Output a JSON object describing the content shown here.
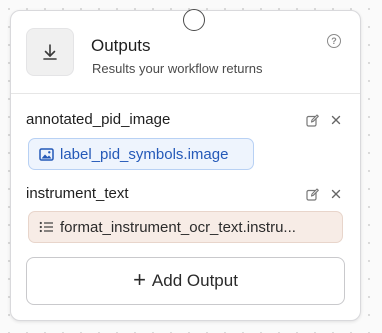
{
  "node": {
    "title": "Outputs",
    "subtitle": "Results your workflow returns",
    "header_icon": "download-arrow-icon",
    "help_icon": "question-circle-icon"
  },
  "outputs": [
    {
      "name": "annotated_pid_image",
      "value": "label_pid_symbols.image",
      "value_icon": "image-icon",
      "chip_color": "#eef4fd",
      "text_color": "#2459b8"
    },
    {
      "name": "instrument_text",
      "value": "format_instrument_ocr_text.instru...",
      "value_icon": "list-icon",
      "chip_color": "#f7ece6",
      "text_color": "#2b2b2b"
    }
  ],
  "add_button": {
    "label": "Add Output",
    "icon": "plus-icon"
  },
  "colors": {
    "border": "#d9d9dc",
    "blue_accent": "#2459b8"
  }
}
